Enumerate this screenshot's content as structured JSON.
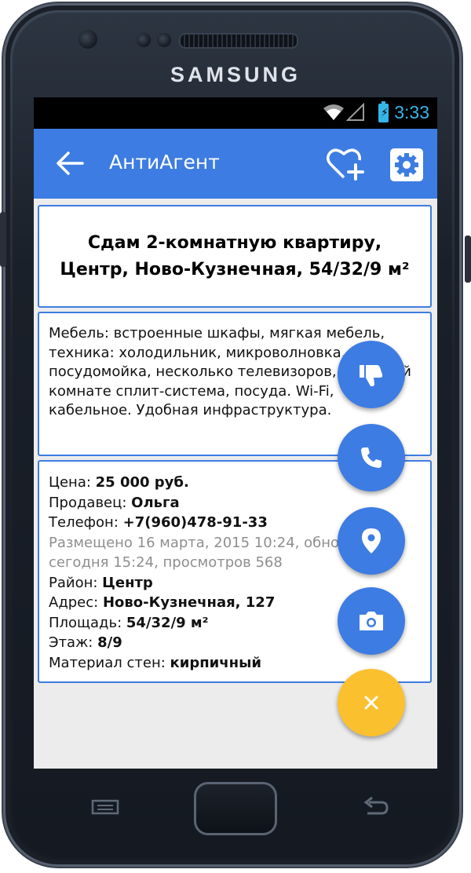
{
  "device": {
    "brand": "SAMSUNG"
  },
  "statusbar": {
    "time": "3:33"
  },
  "appbar": {
    "title": "АнтиАгент"
  },
  "listing": {
    "title": "Сдам 2-комнатную квартиру, Центр, Ново-Кузнечная, 54/32/9 м²",
    "description": "Мебель: встроенные шкафы,  мягкая мебель, техника: холодильник, микроволновка, посудомойка, несколько телевизоров, в каждой комнате сплит-система, посуда. Wi-Fi, кабельное. Удобная инфраструктура.",
    "price_label": "Цена: ",
    "price_value": "25 000 руб.",
    "seller_label": "Продавец: ",
    "seller_value": "Ольга",
    "phone_label": "Телефон: ",
    "phone_value": "+7(960)478-91-33",
    "posted_line1": "Размещено 16 марта, 2015 10:24, обновлено",
    "posted_line2": "сегодня 15:24, просмотров 568",
    "district_label": "Район: ",
    "district_value": "Центр",
    "address_label": "Адрес: ",
    "address_value": "Ново-Кузнечная, 127",
    "area_label": "Площадь: ",
    "area_value": "54/32/9 м²",
    "floor_label": "Этаж: ",
    "floor_value": "8/9",
    "walls_label": "Материал стен: ",
    "walls_value": "кирпичный"
  },
  "fabs": [
    {
      "icon": "thumb-down-icon"
    },
    {
      "icon": "phone-icon"
    },
    {
      "icon": "map-pin-icon"
    },
    {
      "icon": "camera-icon"
    },
    {
      "icon": "close-icon"
    }
  ],
  "colors": {
    "accent": "#3d7ce2",
    "fab_close": "#fbc02d",
    "status_blue": "#35b5e8"
  }
}
